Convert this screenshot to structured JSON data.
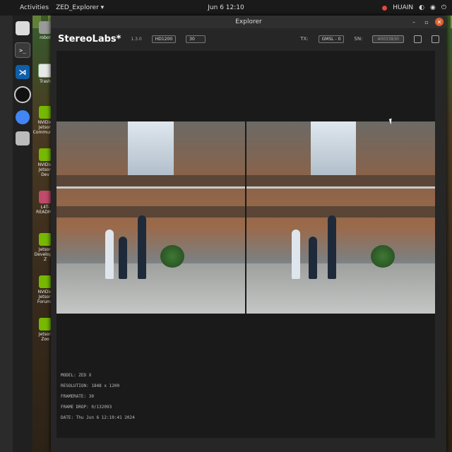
{
  "topbar": {
    "activities": "Activities",
    "app_menu": "ZED_Explorer ▾",
    "clock": "Jun 6 12:10",
    "indicators": [
      "HUAIN"
    ]
  },
  "dock": {
    "apps": [
      "files-icon",
      "terminal-icon",
      "vscode-icon",
      "obs-icon",
      "chromium-icon",
      "disk-icon"
    ]
  },
  "desktop": {
    "icons": [
      {
        "label": "robot"
      },
      {
        "label": "Trash"
      },
      {
        "label": "NVIDIA Jetson Community"
      },
      {
        "label": "NVIDIA Jetson Dev"
      },
      {
        "label": "L4T-README"
      },
      {
        "label": "Jetson Developer Z"
      },
      {
        "label": "NVIDIA Jetson Forums"
      },
      {
        "label": "Jetson Zoo"
      }
    ]
  },
  "window": {
    "title": "Explorer",
    "brand": "StereoLabs*",
    "version": "1.3.0",
    "resolution_select": "HD1200",
    "fps_select": "30",
    "tx_label": "TX:",
    "tx_value": "GMSL - 0",
    "sn_label": "SN:",
    "sn_value": "40033830"
  },
  "info": {
    "model": "MODEL: ZED X",
    "resolution": "RESOLUTION: 1848 x 1200",
    "framerate": "FRAMERATE: 30",
    "frame_drop": "FRAME DROP: 0/132093",
    "date": "DATE: Thu Jun 6 12:10:41 2024"
  }
}
